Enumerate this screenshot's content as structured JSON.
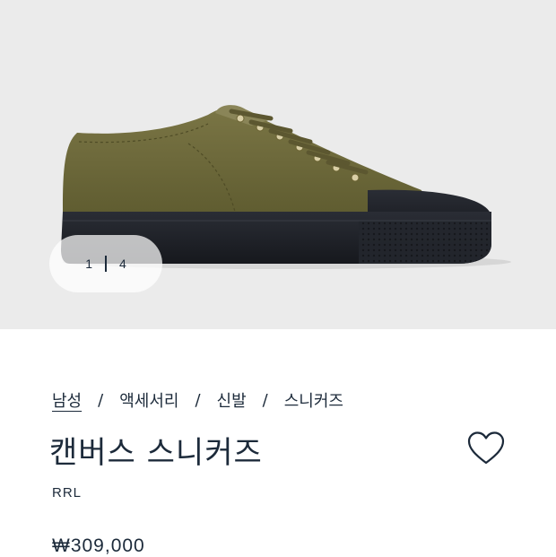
{
  "gallery": {
    "current": "1",
    "total": "4",
    "image_alt": "khaki canvas low-top sneaker with black rubber toe cap and sole"
  },
  "breadcrumb": {
    "items": [
      {
        "label": "남성",
        "link": true
      },
      {
        "label": "액세서리",
        "link": false
      },
      {
        "label": "신발",
        "link": false
      },
      {
        "label": "스니커즈",
        "link": false
      }
    ],
    "separator": "/"
  },
  "product": {
    "title": "캔버스 스니커즈",
    "brand": "RRL",
    "price": "₩309,000",
    "wishlist_icon": "heart-icon"
  },
  "colors": {
    "text": "#1c2a3a",
    "hero_bg": "#ebebeb",
    "canvas": "#6e6a3a",
    "rubber": "#1f2229"
  }
}
